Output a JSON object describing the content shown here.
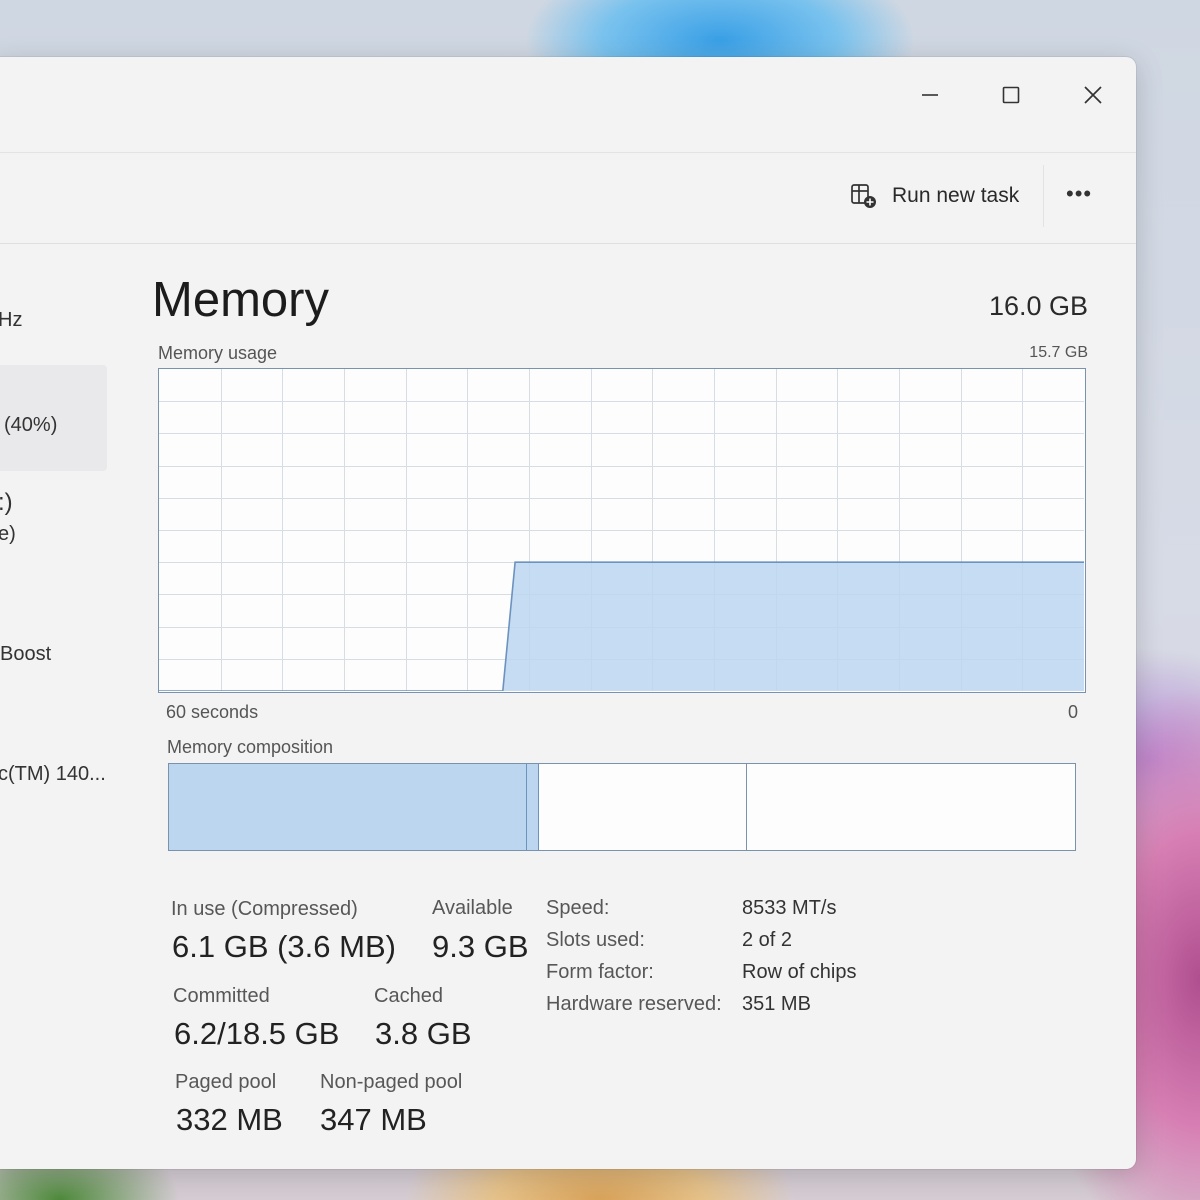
{
  "window": {
    "controls": {
      "minimize_icon": "minimize-icon",
      "maximize_icon": "maximize-icon",
      "close_icon": "close-icon"
    }
  },
  "toolbar": {
    "run_new_task": "Run new task",
    "more": "•••"
  },
  "sidebar": {
    "items": [
      {
        "label": "Hz"
      },
      {
        "label": "(40%)"
      },
      {
        "label": ":)"
      },
      {
        "label": "e)"
      },
      {
        "label": "Boost"
      },
      {
        "label": "c(TM) 140..."
      }
    ]
  },
  "memory": {
    "title": "Memory",
    "total": "16.0 GB",
    "usage_label": "Memory usage",
    "usage_max": "15.7 GB",
    "time_left": "60 seconds",
    "time_right": "0",
    "composition_label": "Memory composition",
    "usage_series": {
      "unit": "fraction of 15.7 GB",
      "points": [
        {
          "t": 60,
          "v": 0.0
        },
        {
          "t": 37.7,
          "v": 0.0
        },
        {
          "t": 36.9,
          "v": 0.4
        },
        {
          "t": 0,
          "v": 0.4
        }
      ]
    },
    "composition_fractions": {
      "in_use": 0.396,
      "modified": 0.013,
      "standby": 0.23,
      "free": 0.361
    },
    "colors": {
      "fill": "#bcd6f0",
      "line": "#6b93be",
      "border": "#7a92ad",
      "grid": "#d6dde5"
    }
  },
  "stats": {
    "in_use_label": "In use (Compressed)",
    "in_use_value": "6.1 GB (3.6 MB)",
    "available_label": "Available",
    "available_value": "9.3 GB",
    "committed_label": "Committed",
    "committed_value": "6.2/18.5 GB",
    "cached_label": "Cached",
    "cached_value": "3.8 GB",
    "paged_label": "Paged pool",
    "paged_value": "332 MB",
    "nonpaged_label": "Non-paged pool",
    "nonpaged_value": "347 MB"
  },
  "details": [
    {
      "key": "Speed:",
      "value": "8533 MT/s"
    },
    {
      "key": "Slots used:",
      "value": "2 of 2"
    },
    {
      "key": "Form factor:",
      "value": "Row of chips"
    },
    {
      "key": "Hardware reserved:",
      "value": "351 MB"
    }
  ]
}
